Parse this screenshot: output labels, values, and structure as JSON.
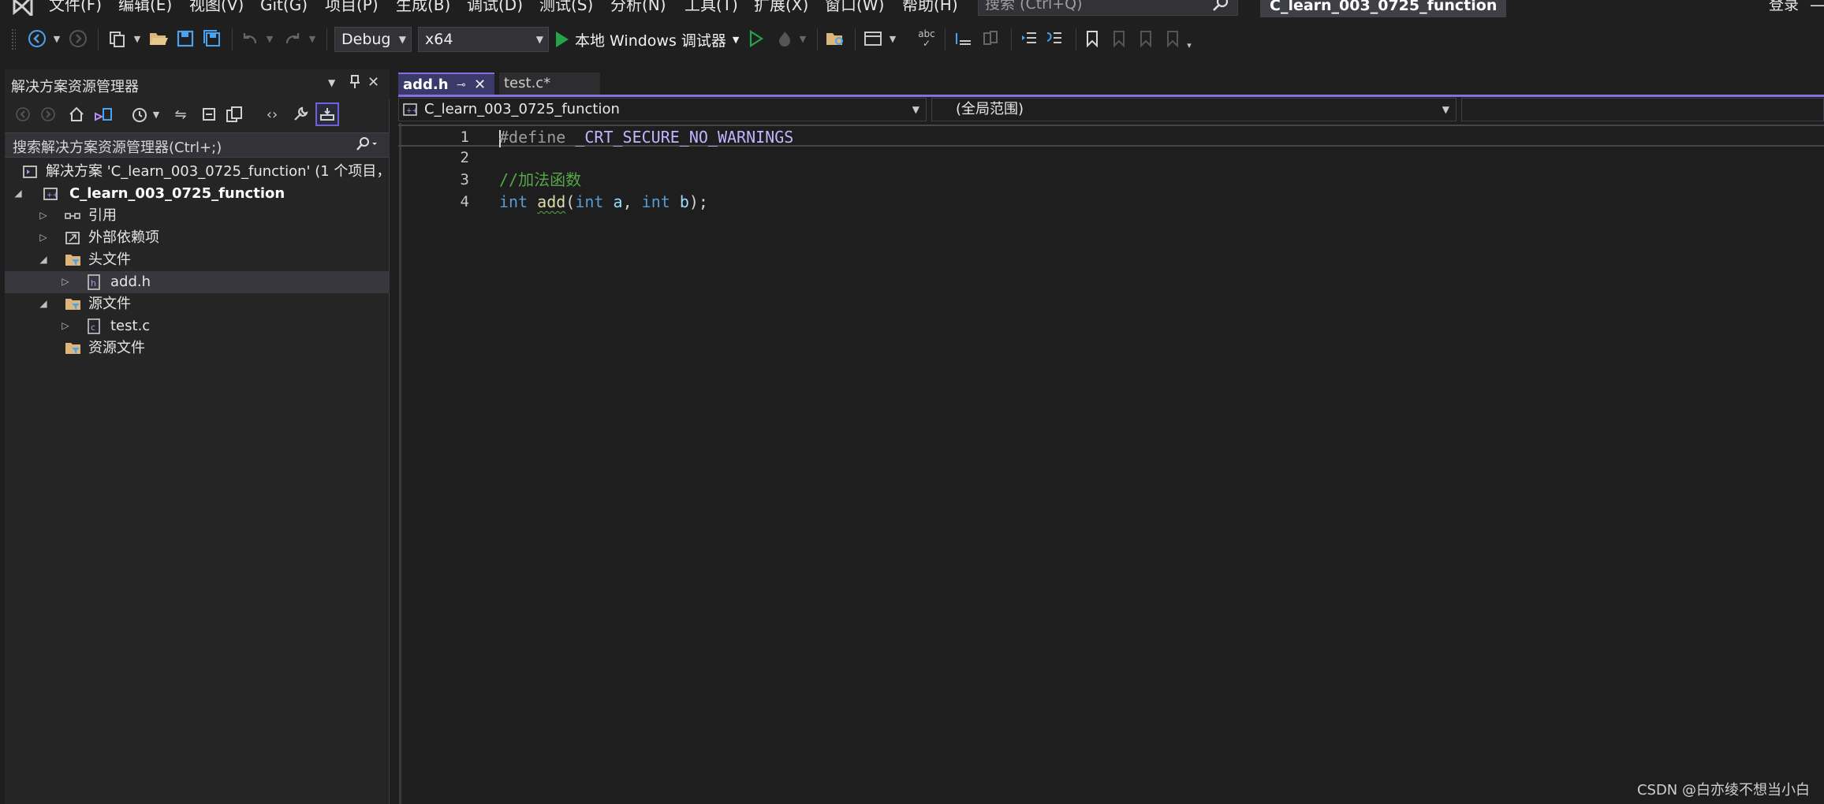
{
  "menubar": {
    "items": [
      "文件(F)",
      "编辑(E)",
      "视图(V)",
      "Git(G)",
      "项目(P)",
      "生成(B)",
      "调试(D)",
      "测试(S)",
      "分析(N)",
      "工具(T)",
      "扩展(X)",
      "窗口(W)",
      "帮助(H)"
    ],
    "search_placeholder": "搜索 (Ctrl+Q)",
    "solution_name": "C_learn_003_0725_function",
    "login": "登录"
  },
  "toolbar": {
    "config": "Debug",
    "platform": "x64",
    "run_label": "本地 Windows 调试器"
  },
  "solution_explorer": {
    "title": "解决方案资源管理器",
    "search_placeholder": "搜索解决方案资源管理器(Ctrl+;)",
    "tree": {
      "solution": "解决方案 'C_learn_003_0725_function' (1 个项目，共",
      "project": "C_learn_003_0725_function",
      "references": "引用",
      "external_deps": "外部依赖项",
      "header_files": "头文件",
      "add_h": "add.h",
      "source_files": "源文件",
      "test_c": "test.c",
      "resource_files": "资源文件"
    }
  },
  "editor": {
    "tabs": [
      {
        "label": "add.h",
        "active": true
      },
      {
        "label": "test.c*",
        "active": false
      }
    ],
    "nav": {
      "project": "C_learn_003_0725_function",
      "scope": "(全局范围)"
    },
    "lines": [
      {
        "n": "1",
        "tokens": [
          [
            "macro",
            "#define"
          ],
          [
            "plain",
            " "
          ],
          [
            "macroname",
            "_CRT_SECURE_NO_WARNINGS"
          ]
        ]
      },
      {
        "n": "2",
        "tokens": []
      },
      {
        "n": "3",
        "tokens": [
          [
            "comment",
            "//加法函数"
          ]
        ]
      },
      {
        "n": "4",
        "tokens": [
          [
            "kw",
            "int"
          ],
          [
            "plain",
            " "
          ],
          [
            "fn",
            "add"
          ],
          [
            "plain",
            "("
          ],
          [
            "kw",
            "int"
          ],
          [
            "plain",
            " "
          ],
          [
            "param",
            "a"
          ],
          [
            "plain",
            ", "
          ],
          [
            "kw",
            "int"
          ],
          [
            "plain",
            " "
          ],
          [
            "param",
            "b"
          ],
          [
            "plain",
            ");"
          ]
        ]
      }
    ]
  },
  "watermark": "CSDN @白亦绫不想当小白",
  "colors": {
    "accent": "#8670e1",
    "keyword": "#569cd6",
    "comment": "#57a64a",
    "function": "#dcdcaa",
    "macro_name": "#beb7ff",
    "run_green": "#23a44a"
  }
}
